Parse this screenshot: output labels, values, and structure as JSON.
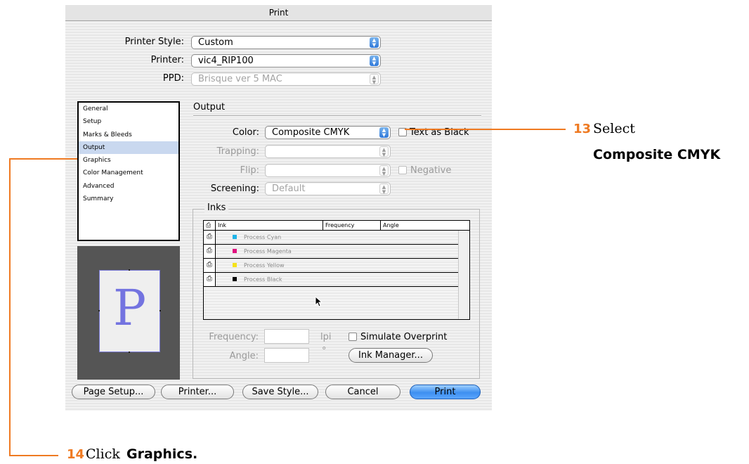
{
  "dialog": {
    "title": "Print",
    "printer_style": {
      "label": "Printer Style:",
      "value": "Custom"
    },
    "printer": {
      "label": "Printer:",
      "value": "vic4_RIP100"
    },
    "ppd": {
      "label": "PPD:",
      "value": "Brisque ver 5 MAC"
    },
    "sidebar": {
      "items": [
        {
          "label": "General",
          "selected": false
        },
        {
          "label": "Setup",
          "selected": false
        },
        {
          "label": "Marks & Bleeds",
          "selected": false
        },
        {
          "label": "Output",
          "selected": true
        },
        {
          "label": "Graphics",
          "selected": false
        },
        {
          "label": "Color Management",
          "selected": false
        },
        {
          "label": "Advanced",
          "selected": false
        },
        {
          "label": "Summary",
          "selected": false
        }
      ]
    },
    "preview": {
      "letter": "P"
    },
    "output": {
      "title": "Output",
      "color": {
        "label": "Color:",
        "value": "Composite CMYK"
      },
      "text_as_black": {
        "label": "Text as Black",
        "checked": false
      },
      "trapping": {
        "label": "Trapping:",
        "value": ""
      },
      "flip": {
        "label": "Flip:",
        "value": ""
      },
      "negative": {
        "label": "Negative",
        "checked": false
      },
      "screening": {
        "label": "Screening:",
        "value": "Default"
      }
    },
    "inks": {
      "title": "Inks",
      "columns": [
        "Ink",
        "Frequency",
        "Angle"
      ],
      "rows": [
        {
          "name": "Process Cyan",
          "color": "#1fb4e8"
        },
        {
          "name": "Process Magenta",
          "color": "#e0117f"
        },
        {
          "name": "Process Yellow",
          "color": "#f5e21a"
        },
        {
          "name": "Process Black",
          "color": "#000000"
        }
      ],
      "frequency": {
        "label": "Frequency:",
        "value": "",
        "unit": "lpi"
      },
      "angle": {
        "label": "Angle:",
        "value": "",
        "unit": "°"
      },
      "simulate_overprint": {
        "label": "Simulate Overprint",
        "checked": false
      },
      "ink_manager_label": "Ink Manager..."
    },
    "buttons": {
      "page_setup": "Page Setup...",
      "printer": "Printer...",
      "save_style": "Save Style...",
      "cancel": "Cancel",
      "print": "Print"
    }
  },
  "callouts": {
    "step13": {
      "number": "13",
      "text": "Select",
      "bold": "Composite CMYK"
    },
    "step14": {
      "number": "14",
      "text": "Click",
      "bold": "Graphics."
    }
  },
  "colors": {
    "accent": "#ef7a22",
    "selection": "#c9d8ef",
    "default_button": "#3e8ff0"
  }
}
